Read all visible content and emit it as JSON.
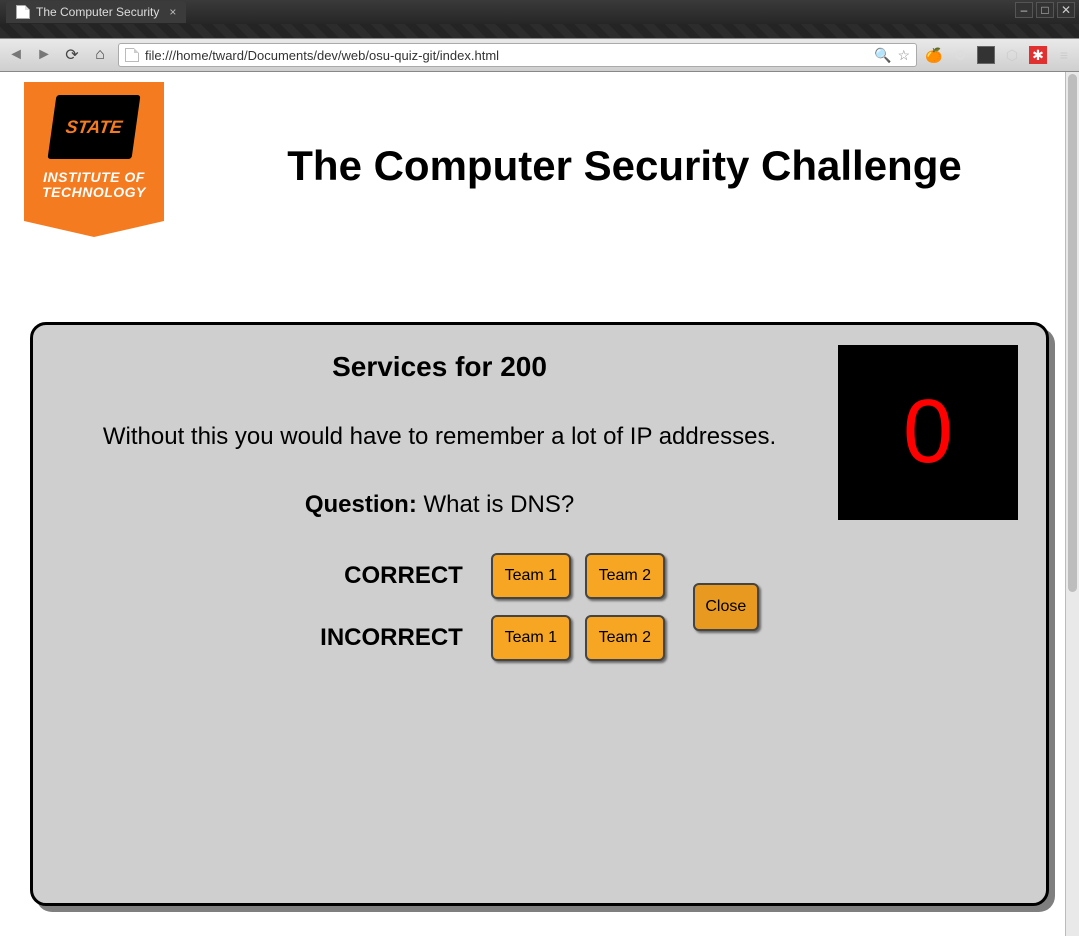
{
  "window": {
    "tab_title": "The Computer Security",
    "buttons": {
      "min": "–",
      "max": "□",
      "close": "✕"
    }
  },
  "toolbar": {
    "url": "file:///home/tward/Documents/dev/web/osu-quiz-git/index.html"
  },
  "header": {
    "title": "The Computer Security Challenge",
    "banner_top": "STATE",
    "banner_line1": "INSTITUTE OF",
    "banner_line2": "TECHNOLOGY"
  },
  "quiz": {
    "category": "Services for 200",
    "clue": "Without this you would have to remember a lot of IP addresses.",
    "question_label": "Question:",
    "answer": "What is DNS?",
    "timer": "0",
    "labels": {
      "correct": "CORRECT",
      "incorrect": "INCORRECT"
    },
    "teams": {
      "t1": "Team 1",
      "t2": "Team 2"
    },
    "close": "Close"
  }
}
